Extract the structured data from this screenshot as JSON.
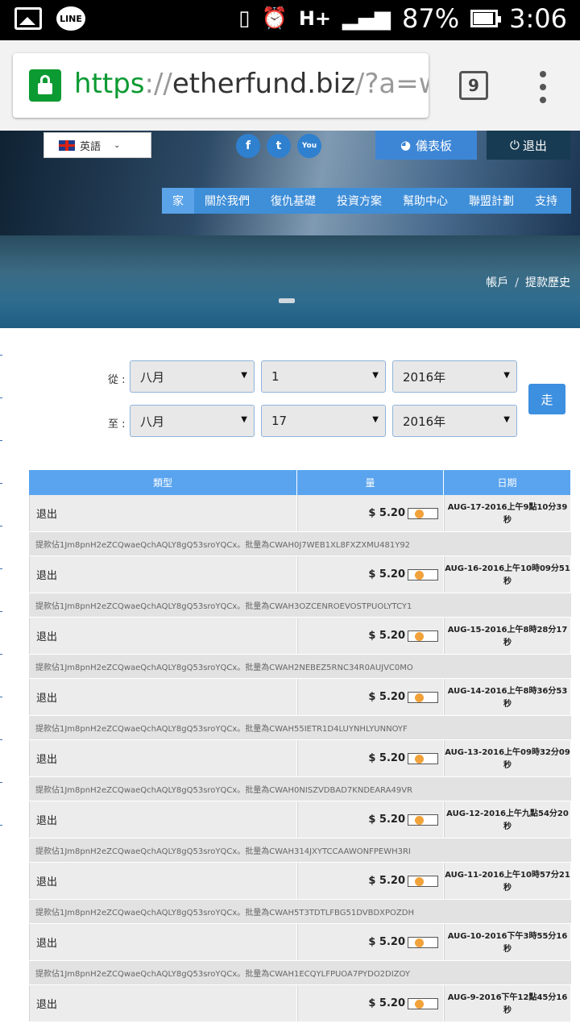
{
  "status_bar": {
    "battery": "87%",
    "time": "3:06",
    "network": "H+",
    "line_label": "LINE"
  },
  "browser": {
    "url_scheme": "https",
    "url_sep": "://",
    "url_host": "etherfund.biz",
    "url_rest": "/?a=wit",
    "tab_count": "9"
  },
  "header": {
    "language": "英語",
    "social": [
      "f",
      "t",
      "You"
    ],
    "dashboard_label": "儀表板",
    "logout_label": "退出",
    "nav": [
      "家",
      "關於我們",
      "復仇基礎",
      "投資方案",
      "幫助中心",
      "聯盟計劃",
      "支持"
    ]
  },
  "breadcrumb": {
    "home": "帳戶",
    "current": "提款歷史"
  },
  "filter": {
    "from_label": "從 :",
    "to_label": "至 :",
    "from_month": "八月",
    "from_day": "1",
    "from_year": "2016年",
    "to_month": "八月",
    "to_day": "17",
    "to_year": "2016年",
    "go_label": "走"
  },
  "table": {
    "headers": [
      "類型",
      "量",
      "日期"
    ],
    "rows": [
      {
        "type": "退出",
        "amount": "$ 5.20",
        "date_line1": "AUG-17-2016上午9點10分39",
        "date_line2": "秒",
        "note": "提款佔1Jm8pnH2eZCQwaeQchAQLY8gQ53sroYQCx。批量為CWAH0J7WEB1XL8FXZXMU481Y92"
      },
      {
        "type": "退出",
        "amount": "$ 5.20",
        "date_line1": "AUG-16-2016上午10時09分51",
        "date_line2": "秒",
        "note": "提款佔1Jm8pnH2eZCQwaeQchAQLY8gQ53sroYQCx。批量為CWAH3OZCENROEVOSTPUOLYTCY1"
      },
      {
        "type": "退出",
        "amount": "$ 5.20",
        "date_line1": "AUG-15-2016上午8時28分17",
        "date_line2": "秒",
        "note": "提款佔1Jm8pnH2eZCQwaeQchAQLY8gQ53sroYQCx。批量為CWAH2NEBEZ5RNC34R0AUJVC0MO"
      },
      {
        "type": "退出",
        "amount": "$ 5.20",
        "date_line1": "AUG-14-2016上午8時36分53",
        "date_line2": "秒",
        "note": "提款佔1Jm8pnH2eZCQwaeQchAQLY8gQ53sroYQCx。批量為CWAH55IETR1D4LUYNHLYUNNOYF"
      },
      {
        "type": "退出",
        "amount": "$ 5.20",
        "date_line1": "AUG-13-2016上午09時32分09",
        "date_line2": "秒",
        "note": "提款佔1Jm8pnH2eZCQwaeQchAQLY8gQ53sroYQCx。批量為CWAH0NISZVDBAD7KNDEARA49VR"
      },
      {
        "type": "退出",
        "amount": "$ 5.20",
        "date_line1": "AUG-12-2016上午九點54分20",
        "date_line2": "秒",
        "note": "提款佔1Jm8pnH2eZCQwaeQchAQLY8gQ53sroYQCx。批量為CWAH314JXYTCCAAWONFPEWH3RI"
      },
      {
        "type": "退出",
        "amount": "$ 5.20",
        "date_line1": "AUG-11-2016上午10時57分21",
        "date_line2": "秒",
        "note": "提款佔1Jm8pnH2eZCQwaeQchAQLY8gQ53sroYQCx。批量為CWAH5T3TDTLFBG51DVBDXPOZDH"
      },
      {
        "type": "退出",
        "amount": "$ 5.20",
        "date_line1": "AUG-10-2016下午3時55分16",
        "date_line2": "秒",
        "note": "提款佔1Jm8pnH2eZCQwaeQchAQLY8gQ53sroYQCx。批量為CWAH1ECQYLFPUOA7PYDO2DIZOY"
      },
      {
        "type": "退出",
        "amount": "$ 5.20",
        "date_line1": "AUG-9-2016下午12點45分16",
        "date_line2": "秒",
        "note": ""
      }
    ]
  },
  "colors": {
    "accent": "#3d86d6",
    "nav": "#3f8ed8",
    "logout": "#173b52",
    "header_row": "#5aa4ef"
  }
}
